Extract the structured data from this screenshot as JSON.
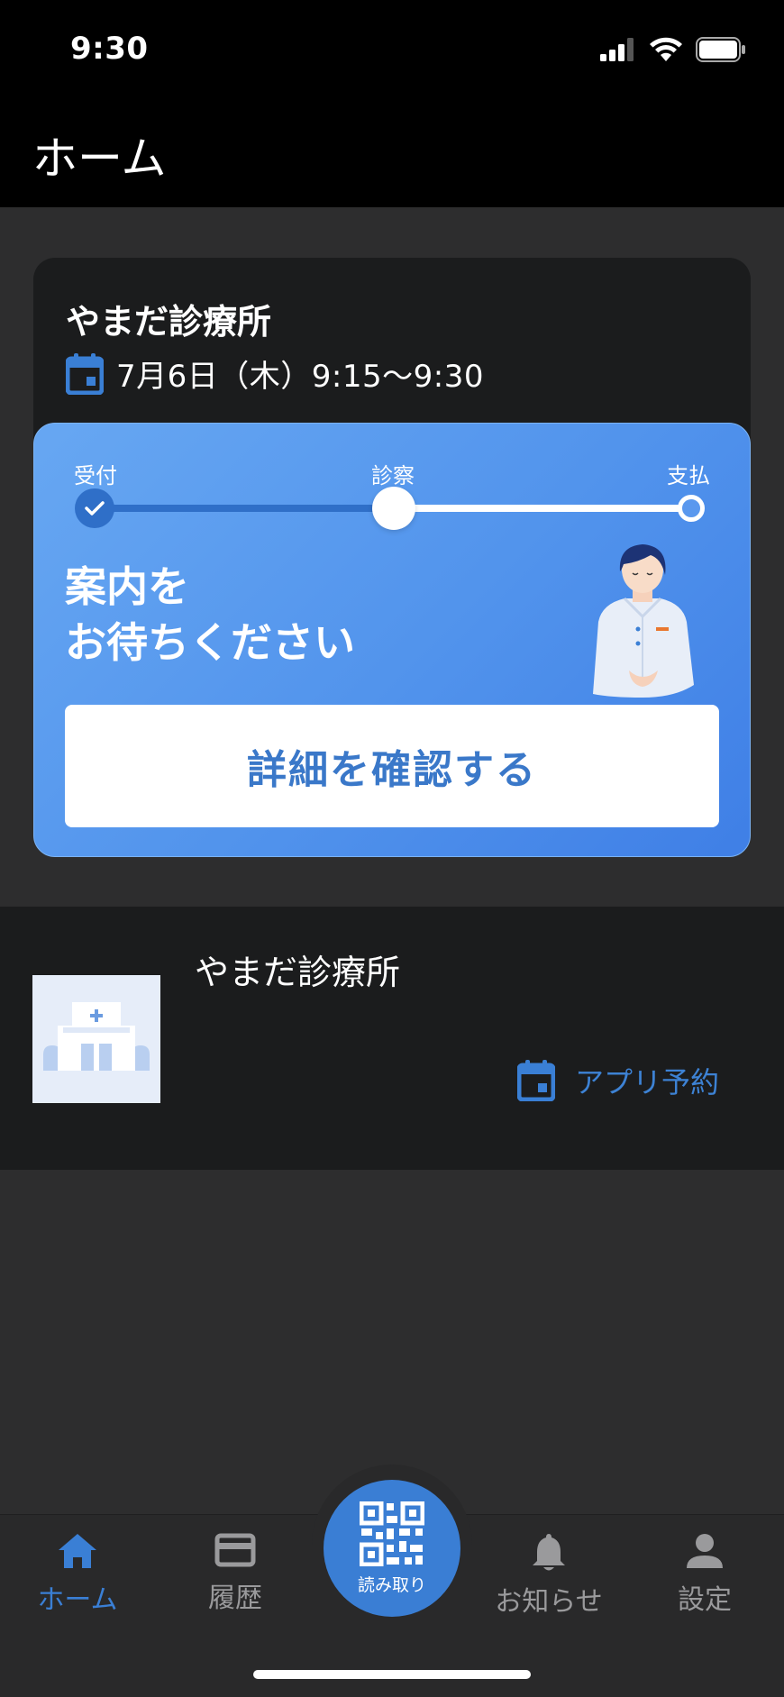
{
  "status_bar": {
    "time": "9:30"
  },
  "header": {
    "title": "ホーム"
  },
  "appointment": {
    "clinic": "やまだ診療所",
    "date": "7月6日（木）9:15〜9:30"
  },
  "progress": {
    "steps": [
      "受付",
      "診察",
      "支払"
    ],
    "current_step": 2,
    "message_line1": "案内を",
    "message_line2": "お待ちください",
    "detail_button": "詳細を確認する"
  },
  "clinic_list": {
    "name": "やまだ診療所",
    "reserve_label": "アプリ予約"
  },
  "nav": {
    "home": "ホーム",
    "history": "履歴",
    "scan": "読み取り",
    "notifications": "お知らせ",
    "settings": "設定"
  },
  "colors": {
    "accent": "#3a7fd5",
    "panel_start": "#67a7f2",
    "panel_end": "#3f7fe6"
  }
}
